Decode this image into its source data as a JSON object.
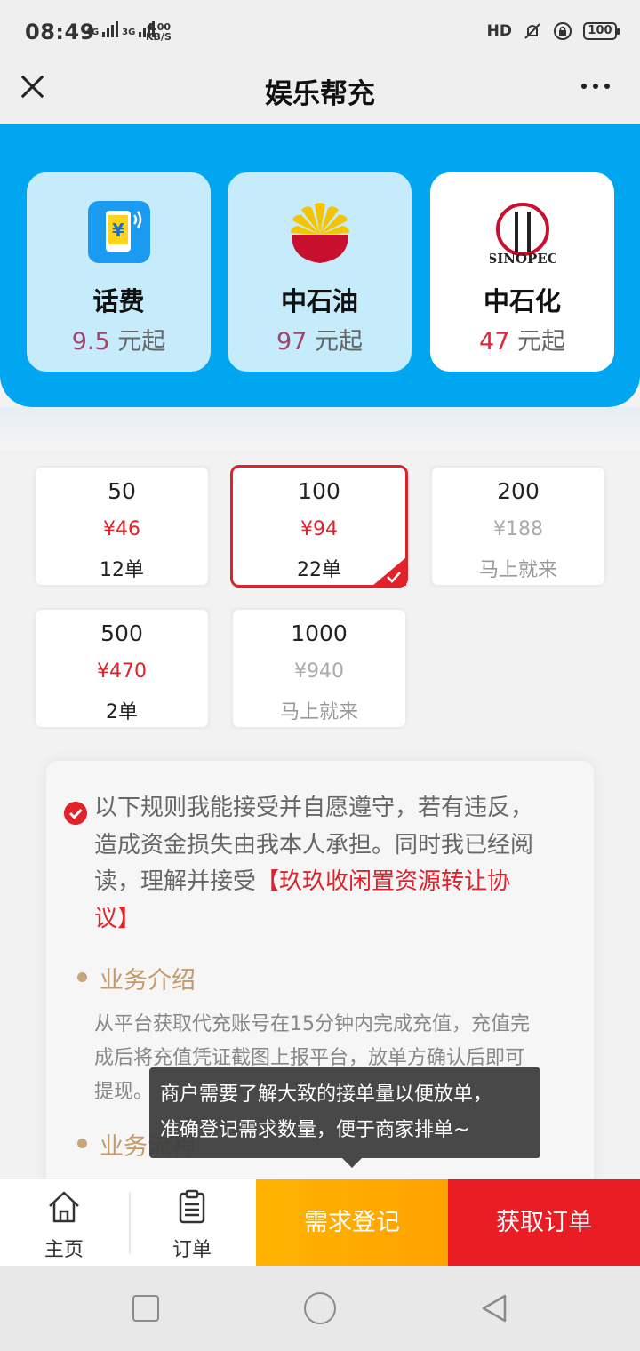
{
  "status_bar": {
    "time": "08:49",
    "net1": "4G",
    "net2": "3G",
    "speed_value": "4.00",
    "speed_unit": "KB/S",
    "hd": "HD",
    "battery": "100"
  },
  "header": {
    "title": "娱乐帮充"
  },
  "categories": [
    {
      "name": "话费",
      "price": "9.5",
      "suffix": " 元起",
      "icon": "phone-recharge-icon"
    },
    {
      "name": "中石油",
      "price": "97",
      "suffix": " 元起",
      "icon": "petrochina-logo-icon"
    },
    {
      "name": "中石化",
      "price": "47",
      "suffix": " 元起",
      "icon": "sinopec-logo-icon"
    }
  ],
  "selected_category": "中石化",
  "amounts": [
    {
      "face": "50",
      "price": "¥46",
      "count": "12单",
      "available": true
    },
    {
      "face": "100",
      "price": "¥94",
      "count": "22单",
      "available": true,
      "selected": true
    },
    {
      "face": "200",
      "price": "¥188",
      "count": "马上就来",
      "available": false
    },
    {
      "face": "500",
      "price": "¥470",
      "count": "2单",
      "available": true
    },
    {
      "face": "1000",
      "price": "¥940",
      "count": "马上就来",
      "available": false
    }
  ],
  "rules": {
    "line1": "以下规则我能接受并自愿遵守，若有违反，",
    "line2": "造成资金损失由我本人承担。同时我已经阅",
    "line3_prefix": "读，理解并接受",
    "link_part1": "【玖玖收闲置资源转让协",
    "link_part2": "议】",
    "section1_title": "业务介绍",
    "intro_line1": "从平台获取代充账号在15分钟内完成充值，充值完",
    "intro_line2": "成后将充值凭证截图上报平台，放单方确认后即可",
    "intro_line3": "提现。",
    "section2_title": "业务流程"
  },
  "tooltip": {
    "line1": "商户需要了解大致的接单量以便放单，",
    "line2": "准确登记需求数量，便于商家排单~"
  },
  "bottom_nav": {
    "home_label": "主页",
    "orders_label": "订单",
    "register_label": "需求登记",
    "get_order_label": "获取订单"
  },
  "colors": {
    "banner": "#00a6f0",
    "accent_red": "#e1222b",
    "register_orange": "#ffa200",
    "section_gold": "#c59a6a"
  }
}
